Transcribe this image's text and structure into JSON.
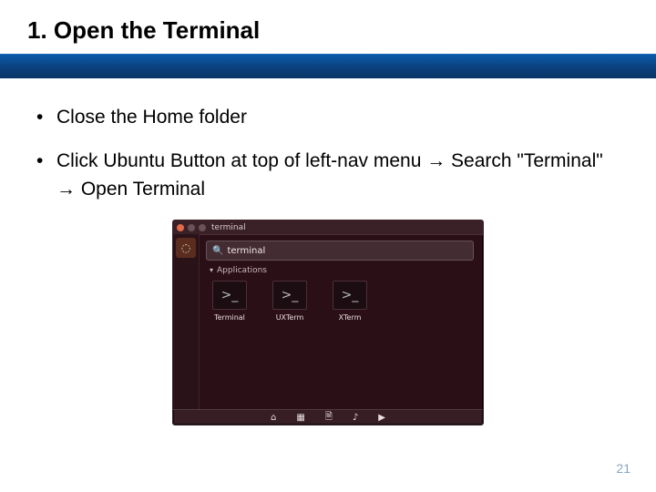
{
  "slide": {
    "title": "1. Open the Terminal",
    "bullets": [
      "Close the Home folder",
      "Click Ubuntu Button at top of left-nav menu → Search \"Terminal\" → Open Terminal"
    ],
    "page_number": "21"
  },
  "screenshot": {
    "window_title": "terminal",
    "search_query": "terminal",
    "category_label": "Applications",
    "launcher_icons": [
      "ubuntu-icon"
    ],
    "results": [
      {
        "label": "Terminal",
        "glyph": ">_"
      },
      {
        "label": "UXTerm",
        "glyph": ">_"
      },
      {
        "label": "XTerm",
        "glyph": ">_"
      }
    ],
    "lenses": [
      "home-icon",
      "apps-icon",
      "files-icon",
      "music-icon",
      "video-icon"
    ]
  }
}
